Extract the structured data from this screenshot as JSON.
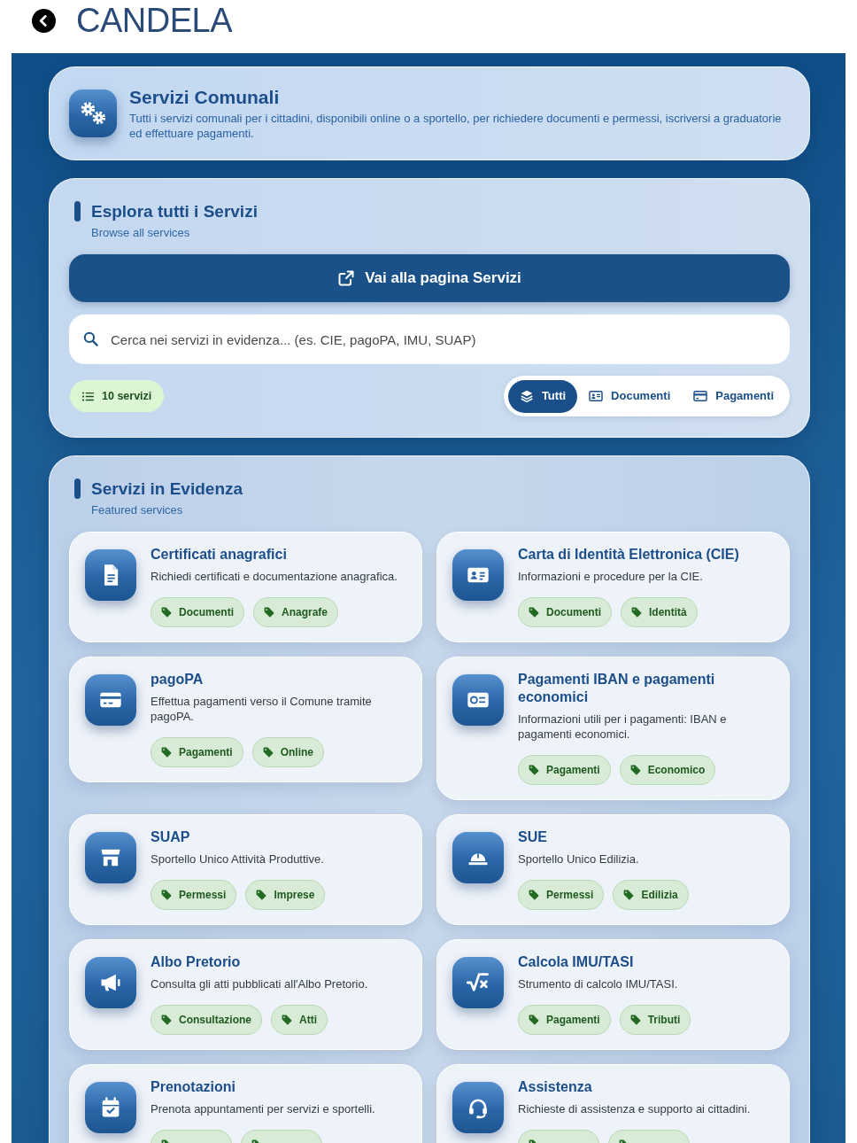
{
  "header": {
    "title": "CANDELA"
  },
  "intro": {
    "title": "Servizi Comunali",
    "description": "Tutti i servizi comunali per i cittadini, disponibili online o a sportello, per richiedere documenti e permessi, iscriversi a graduatorie ed effettuare pagamenti."
  },
  "explore": {
    "title": "Esplora tutti i Servizi",
    "subtitle": "Browse all services",
    "button": "Vai alla pagina Servizi",
    "search": {
      "placeholder": "Cerca nei servizi in evidenza... (es. CIE, pagoPA, IMU, SUAP)"
    },
    "count": "10 servizi",
    "filters": [
      {
        "label": "Tutti",
        "selected": true
      },
      {
        "label": "Documenti",
        "selected": false
      },
      {
        "label": "Pagamenti",
        "selected": false
      }
    ]
  },
  "featured": {
    "title": "Servizi in Evidenza",
    "subtitle": "Featured services",
    "cards": [
      {
        "title": "Certificati anagrafici",
        "description": "Richiedi certificati e documentazione anagrafica.",
        "tags": [
          {
            "label": "Documenti",
            "cut_off": false
          },
          {
            "label": "Anagrafe",
            "cut_off": false
          }
        ]
      },
      {
        "title": "Carta di Identità Elettronica (CIE)",
        "description": "Informazioni e procedure per la CIE.",
        "tags": [
          {
            "label": "Documenti",
            "cut_off": false
          },
          {
            "label": "Identità",
            "cut_off": false
          }
        ]
      },
      {
        "title": "pagoPA",
        "description": "Effettua pagamenti verso il Comune tramite pagoPA.",
        "tags": [
          {
            "label": "Pagamenti",
            "cut_off": false
          },
          {
            "label": "Online",
            "cut_off": false
          }
        ]
      },
      {
        "title": "Pagamenti IBAN e pagamenti economici",
        "description": "Informazioni utili per i pagamenti: IBAN e pagamenti economici.",
        "tags": [
          {
            "label": "Pagamenti",
            "cut_off": false
          },
          {
            "label": "Economico",
            "cut_off": false
          }
        ]
      },
      {
        "title": "SUAP",
        "description": "Sportello Unico Attività Produttive.",
        "tags": [
          {
            "label": "Permessi",
            "cut_off": false
          },
          {
            "label": "Imprese",
            "cut_off": false
          }
        ]
      },
      {
        "title": "SUE",
        "description": "Sportello Unico Edilizia.",
        "tags": [
          {
            "label": "Permessi",
            "cut_off": false
          },
          {
            "label": "Edilizia",
            "cut_off": false
          }
        ]
      },
      {
        "title": "Albo Pretorio",
        "description": "Consulta gli atti pubblicati all'Albo Pretorio.",
        "tags": [
          {
            "label": "Consultazione",
            "cut_off": false
          },
          {
            "label": "Atti",
            "cut_off": false
          }
        ]
      },
      {
        "title": "Calcola IMU/TASI",
        "description": "Strumento di calcolo IMU/TASI.",
        "tags": [
          {
            "label": "Pagamenti",
            "cut_off": false
          },
          {
            "label": "Tributi",
            "cut_off": false
          }
        ]
      },
      {
        "title": "Prenotazioni",
        "description": "Prenota appuntamenti per servizi e sportelli.",
        "tags": [
          {
            "cut_off": true
          },
          {
            "cut_off": true
          }
        ]
      },
      {
        "title": "Assistenza",
        "description": "Richieste di assistenza e supporto ai cittadini.",
        "tags": [
          {
            "cut_off": true
          },
          {
            "cut_off": true
          }
        ]
      }
    ]
  }
}
